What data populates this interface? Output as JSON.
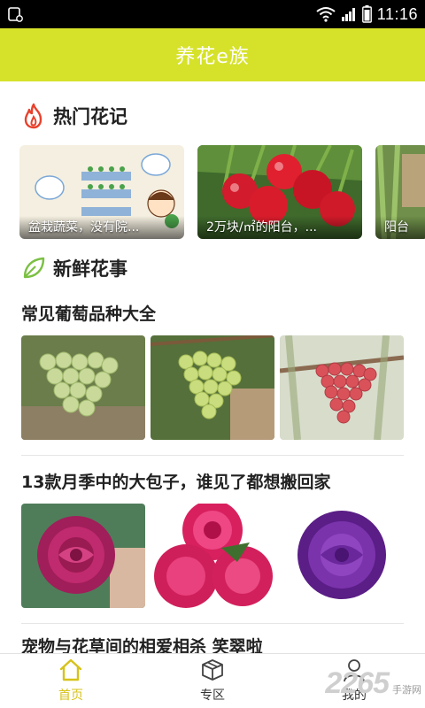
{
  "status_bar": {
    "time": "11:16"
  },
  "header": {
    "title": "养花e族"
  },
  "hot_section": {
    "heading": "热门花记",
    "cards": [
      {
        "caption": "盆栽蔬菜，没有院..."
      },
      {
        "caption": "2万块/㎡的阳台，..."
      },
      {
        "caption": "阳台"
      }
    ]
  },
  "fresh_section": {
    "heading": "新鲜花事",
    "articles": [
      {
        "title": "常见葡萄品种大全"
      },
      {
        "title": "13款月季中的大包子，谁见了都想搬回家"
      },
      {
        "title": "宠物与花草间的相爱相杀 笑翠啦"
      }
    ]
  },
  "bottom_nav": {
    "tabs": [
      {
        "label": "首页",
        "active": true
      },
      {
        "label": "专区",
        "active": false
      },
      {
        "label": "我的",
        "active": false
      }
    ]
  },
  "watermark": {
    "number": "2265",
    "text": "手游网"
  },
  "colors": {
    "accent": "#d6e22a",
    "active_tab": "#d6c21a",
    "hot_icon": "#e8412c",
    "leaf_icon": "#7bc043"
  }
}
